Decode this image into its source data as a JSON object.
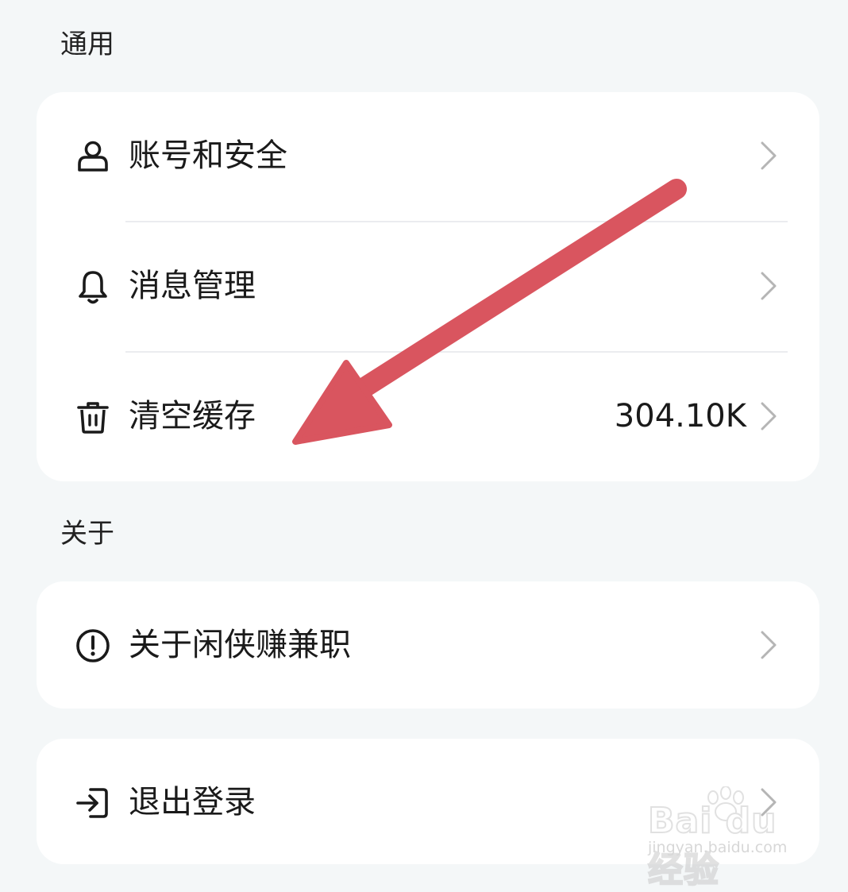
{
  "sections": {
    "general": {
      "title": "通用",
      "items": [
        {
          "label": "账号和安全",
          "icon": "user-icon",
          "value": ""
        },
        {
          "label": "消息管理",
          "icon": "bell-icon",
          "value": ""
        },
        {
          "label": "清空缓存",
          "icon": "trash-icon",
          "value": "304.10K"
        }
      ]
    },
    "about": {
      "title": "关于",
      "items": [
        {
          "label": "关于闲侠赚兼职",
          "icon": "info-circle-icon",
          "value": ""
        }
      ]
    },
    "logout": {
      "items": [
        {
          "label": "退出登录",
          "icon": "logout-icon",
          "value": ""
        }
      ]
    }
  },
  "annotation": {
    "arrow_color": "#d9555f",
    "points_to": "清空缓存"
  },
  "watermark": {
    "brand": "Bai du 经验",
    "url": "jingyan.baidu.com"
  },
  "colors": {
    "background": "#f4f7f8",
    "card": "#ffffff",
    "divider": "#ebecef",
    "chevron": "#b5b5b5",
    "text": "#1a1a1a"
  }
}
